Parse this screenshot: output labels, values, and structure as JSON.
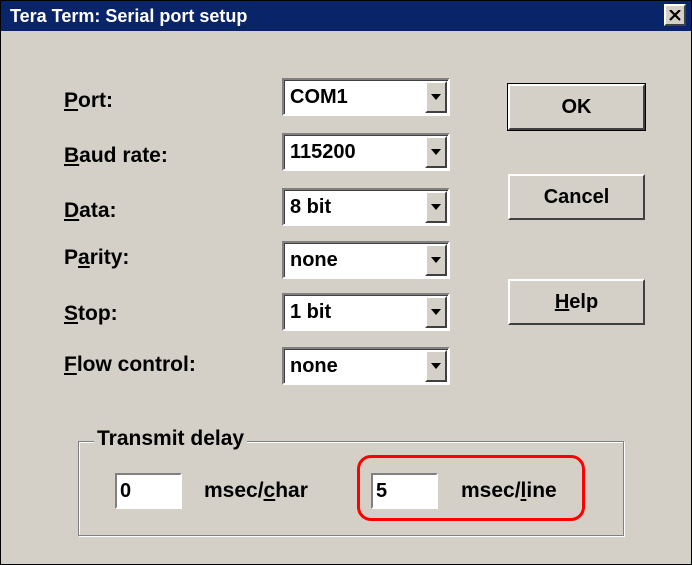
{
  "window": {
    "title": "Tera Term: Serial port setup",
    "close_icon": "close-x-icon"
  },
  "fields": {
    "port": {
      "label_prefix": "",
      "label_mnemonic": "P",
      "label_rest": "ort:",
      "value": "COM1"
    },
    "baud": {
      "label_prefix": "",
      "label_mnemonic": "B",
      "label_rest": "aud rate:",
      "value": "115200"
    },
    "data": {
      "label_prefix": "",
      "label_mnemonic": "D",
      "label_rest": "ata:",
      "value": "8 bit"
    },
    "parity": {
      "label_prefix": "P",
      "label_mnemonic": "a",
      "label_rest": "rity:",
      "value": "none"
    },
    "stop": {
      "label_prefix": "",
      "label_mnemonic": "S",
      "label_rest": "top:",
      "value": "1 bit"
    },
    "flow": {
      "label_prefix": "",
      "label_mnemonic": "F",
      "label_rest": "low control:",
      "value": "none"
    }
  },
  "buttons": {
    "ok": "OK",
    "cancel": "Cancel",
    "help_mnemonic": "H",
    "help_rest": "elp"
  },
  "transmit_delay": {
    "title": "Transmit delay",
    "char_value": "0",
    "char_unit_prefix": "msec/",
    "char_unit_mnemonic": "c",
    "char_unit_rest": "har",
    "line_value": "5",
    "line_unit_prefix": "msec/",
    "line_unit_mnemonic": "l",
    "line_unit_rest": "ine"
  },
  "colors": {
    "title_bar": "#0a246a",
    "dialog_face": "#d4d0c8",
    "highlight": "#ff0000"
  }
}
